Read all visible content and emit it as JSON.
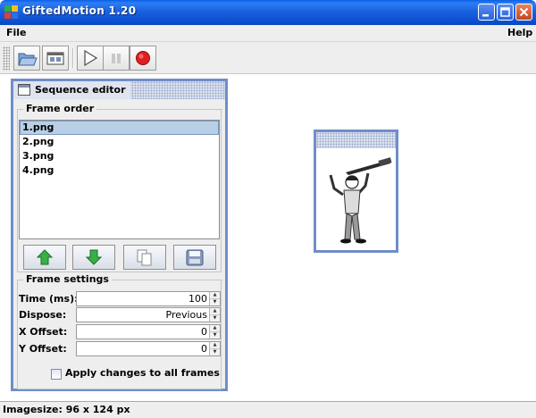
{
  "window": {
    "title": "GiftedMotion 1.20"
  },
  "menu": {
    "file": "File",
    "help": "Help"
  },
  "toolbar": {
    "buttons": [
      "open-folder-icon",
      "frames-icon",
      "play-icon",
      "pause-icon",
      "record-icon"
    ],
    "colors": {
      "record": "#e02020",
      "play": "#555555"
    }
  },
  "editor": {
    "title": "Sequence editor",
    "frame_order_label": "Frame order",
    "frames": [
      "1.png",
      "2.png",
      "3.png",
      "4.png"
    ],
    "selected_index": 0,
    "buttons": [
      "move-up-icon",
      "move-down-icon",
      "copy-icon",
      "save-icon"
    ],
    "frame_settings_label": "Frame settings",
    "fields": {
      "time_label": "Time (ms):",
      "time_value": "100",
      "dispose_label": "Dispose:",
      "dispose_value": "Previous",
      "xoff_label": "X Offset:",
      "xoff_value": "0",
      "yoff_label": "Y Offset:",
      "yoff_value": "0"
    },
    "apply_all_label": "Apply changes to all frames",
    "apply_all_checked": false
  },
  "status": {
    "text": "Imagesize: 96 x 124 px"
  },
  "colors": {
    "frame_border": "#6f8ec8",
    "titlebar": "#0b4fd0",
    "selection": "#b8cfe5"
  }
}
